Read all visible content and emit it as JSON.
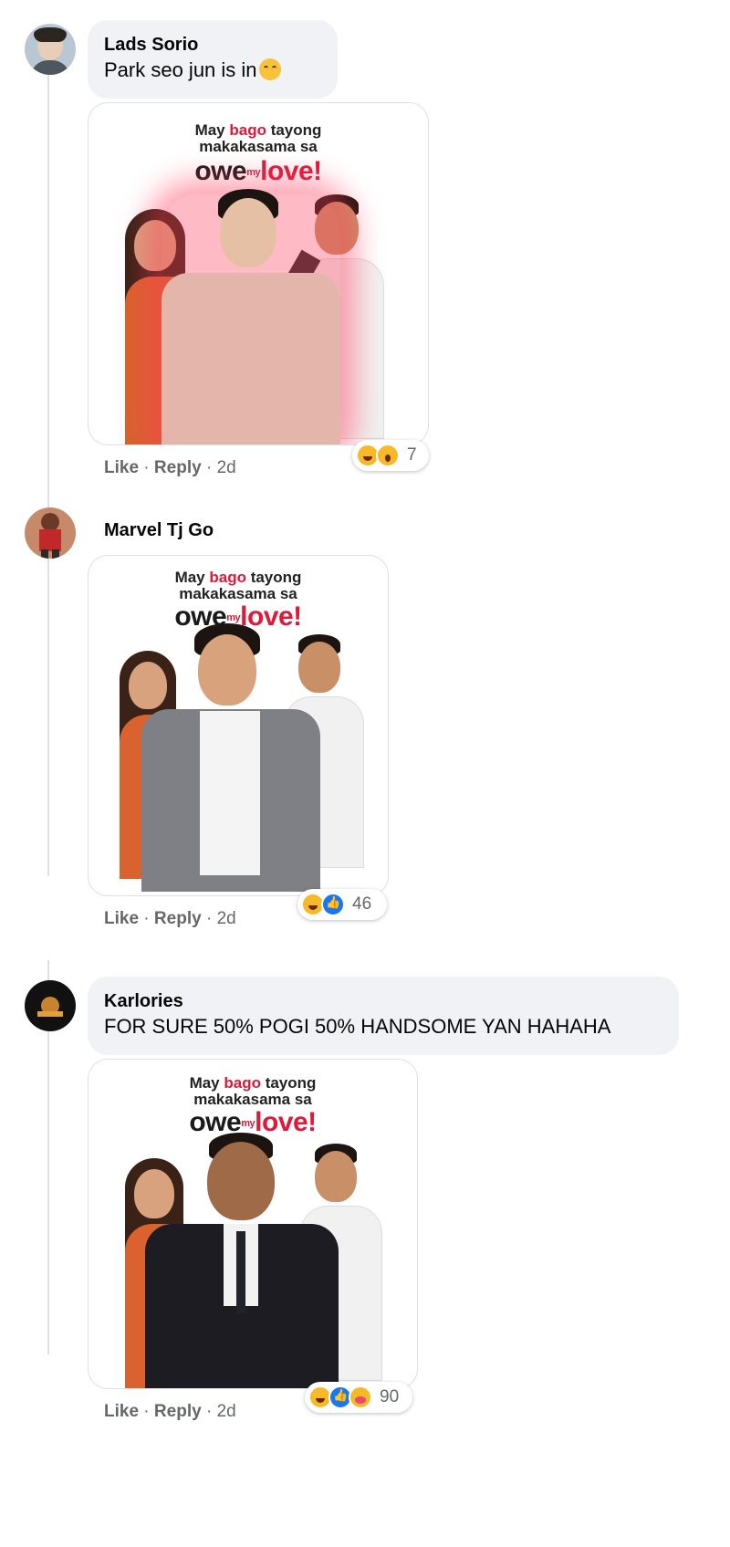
{
  "comments": [
    {
      "author": "Lads Sorio",
      "text": "Park seo jun is in",
      "poster": {
        "line1_pre": "May ",
        "line1_accent": "bago",
        "line1_post": " tayong",
        "line2": "makakasama sa",
        "brand_pre": "owe",
        "brand_mid": "my",
        "brand_post": "love",
        "brand_bang": "!"
      },
      "actions": {
        "like": "Like",
        "reply": "Reply",
        "time": "2d"
      },
      "reaction_count": "7",
      "reactions": [
        "haha-icon",
        "wow-icon"
      ]
    },
    {
      "author": "Marvel Tj Go",
      "text": "",
      "poster": {
        "line1_pre": "May ",
        "line1_accent": "bago",
        "line1_post": " tayong",
        "line2": "makakasama sa",
        "brand_pre": "owe",
        "brand_mid": "my",
        "brand_post": "love",
        "brand_bang": "!"
      },
      "actions": {
        "like": "Like",
        "reply": "Reply",
        "time": "2d"
      },
      "reaction_count": "46",
      "reactions": [
        "haha-icon",
        "like-icon"
      ]
    },
    {
      "author": "Karlories",
      "text": "FOR SURE 50% POGI 50% HANDSOME YAN HAHAHA",
      "poster": {
        "line1_pre": "May ",
        "line1_accent": "bago",
        "line1_post": " tayong",
        "line2": "makakasama sa",
        "brand_pre": "owe",
        "brand_mid": "my",
        "brand_post": "love",
        "brand_bang": "!"
      },
      "actions": {
        "like": "Like",
        "reply": "Reply",
        "time": "2d"
      },
      "reaction_count": "90",
      "reactions": [
        "haha-icon",
        "like-icon",
        "care-icon"
      ]
    }
  ],
  "colors": {
    "accent": "#e0193a",
    "bubble": "#f0f2f5",
    "meta": "#65676b"
  }
}
